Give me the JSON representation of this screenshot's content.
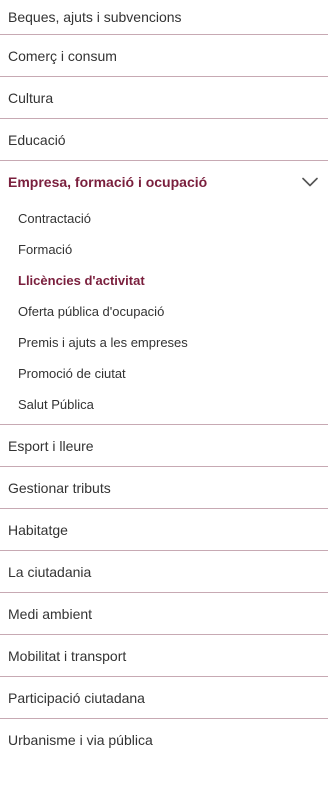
{
  "menu": {
    "items_before": [
      "Beques, ajuts i subvencions",
      "Comerç i consum",
      "Cultura",
      "Educació"
    ],
    "expanded": {
      "label": "Empresa, formació i ocupació",
      "chevron_icon": "chevron-down-icon",
      "subitems": [
        "Contractació",
        "Formació",
        "Llicències d'activitat",
        "Oferta pública d'ocupació",
        "Premis i ajuts a les empreses",
        "Promoció de ciutat",
        "Salut Pública"
      ],
      "active_subitem": "Llicències d'activitat"
    },
    "items_after": [
      "Esport i lleure",
      "Gestionar tributs",
      "Habitatge",
      "La ciutadania",
      "Medi ambient",
      "Mobilitat i transport",
      "Participació ciutadana",
      "Urbanisme i via pública"
    ]
  },
  "colors": {
    "accent": "#7a1f3d",
    "divider": "#c7a9b3",
    "text": "#333333"
  }
}
